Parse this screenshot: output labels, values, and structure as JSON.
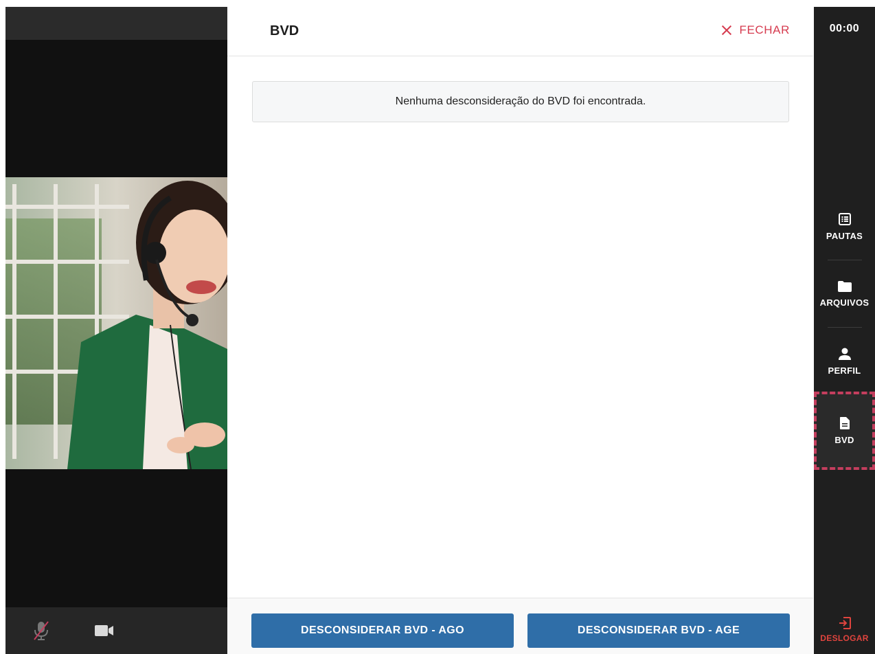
{
  "panel": {
    "title": "BVD",
    "close_label": "FECHAR",
    "empty_message": "Nenhuma desconsideração do BVD foi encontrada.",
    "buttons": {
      "ago": "DESCONSIDERAR BVD - AGO",
      "age": "DESCONSIDERAR BVD - AGE"
    }
  },
  "nav": {
    "timer": "00:00",
    "items": [
      {
        "label": "PAUTAS",
        "icon": "list-icon",
        "active": false
      },
      {
        "label": "ARQUIVOS",
        "icon": "folder-icon",
        "active": false
      },
      {
        "label": "PERFIL",
        "icon": "person-icon",
        "active": false
      },
      {
        "label": "BVD",
        "icon": "document-icon",
        "active": true
      }
    ],
    "logout_label": "DESLOGAR"
  },
  "video": {
    "mic": "muted",
    "camera": "on"
  },
  "colors": {
    "accent_red": "#d63b4f",
    "button_blue": "#2f6ea8",
    "nav_bg": "#1f1f1f",
    "active_outline": "#c43e5e"
  }
}
